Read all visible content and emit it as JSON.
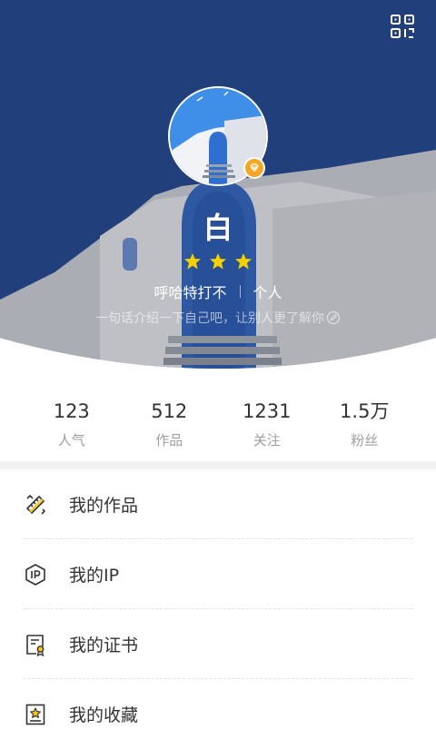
{
  "profile": {
    "nickname": "白",
    "star_count": 3,
    "name_tag": "呼哈特打不",
    "type_tag": "个人",
    "bio_placeholder": "一句话介绍一下自己吧，让别人更了解你"
  },
  "stats": [
    {
      "value": "123",
      "label": "人气"
    },
    {
      "value": "512",
      "label": "作品"
    },
    {
      "value": "1231",
      "label": "关注"
    },
    {
      "value": "1.5万",
      "label": "粉丝"
    }
  ],
  "menu": [
    {
      "label": "我的作品",
      "icon": "pencil-ruler-icon"
    },
    {
      "label": "我的IP",
      "icon": "ip-hexagon-icon"
    },
    {
      "label": "我的证书",
      "icon": "certificate-icon"
    },
    {
      "label": "我的收藏",
      "icon": "favorite-star-icon"
    }
  ],
  "colors": {
    "sky": "#27498a",
    "accent": "#f5c518",
    "icon_ink": "#333333"
  }
}
